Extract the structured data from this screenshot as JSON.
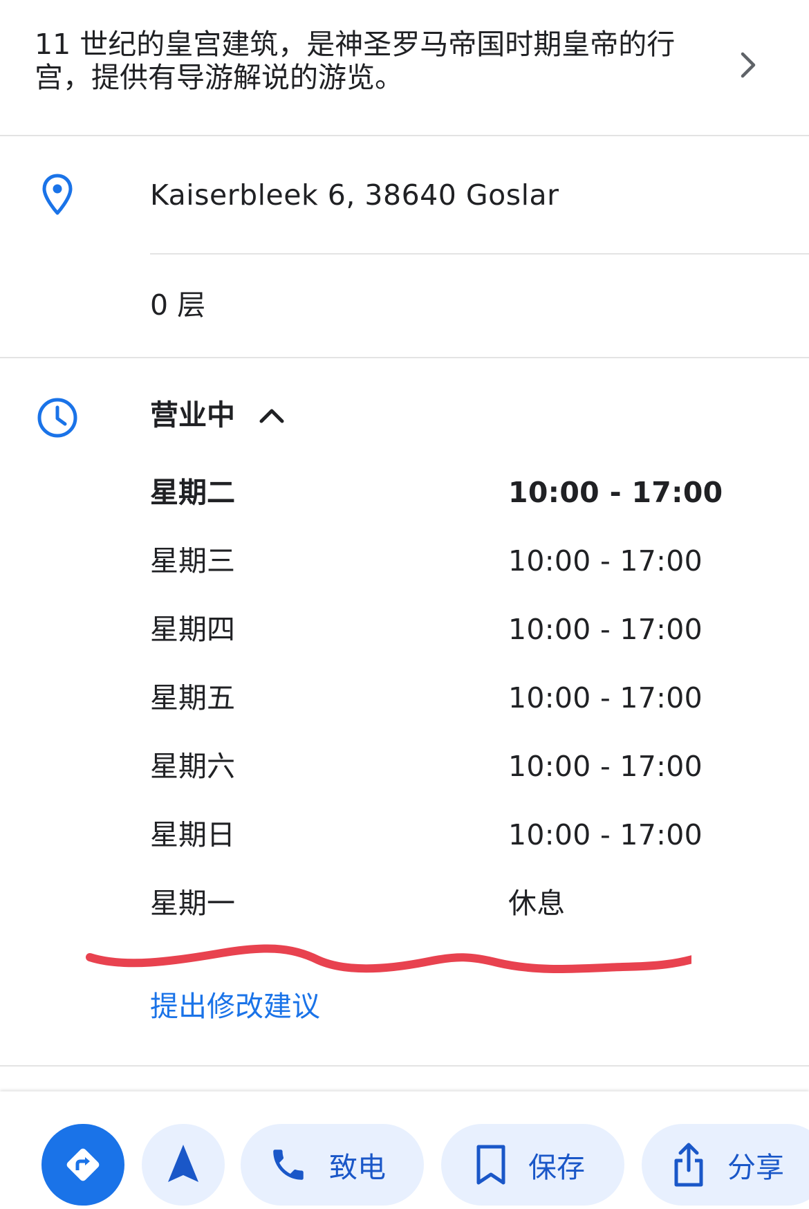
{
  "description": "11 世纪的皇宫建筑，是神圣罗马帝国时期皇帝的行宫，提供有导游解说的游览。",
  "address": "Kaiserbleek 6, 38640 Goslar",
  "floor": "0 层",
  "hours": {
    "status": "营业中",
    "days": [
      {
        "day": "星期二",
        "time": "10:00 - 17:00"
      },
      {
        "day": "星期三",
        "time": "10:00 - 17:00"
      },
      {
        "day": "星期四",
        "time": "10:00 - 17:00"
      },
      {
        "day": "星期五",
        "time": "10:00 - 17:00"
      },
      {
        "day": "星期六",
        "time": "10:00 - 17:00"
      },
      {
        "day": "星期日",
        "time": "10:00 - 17:00"
      },
      {
        "day": "星期一",
        "time": "休息"
      }
    ],
    "current_day": "星期二"
  },
  "suggest_edit": "提出修改建议",
  "actions": {
    "call": "致电",
    "save": "保存",
    "share": "分享"
  },
  "icons": {
    "description": "chevron-right-icon",
    "address": "location-pin-icon",
    "hours": "clock-icon",
    "hours_toggle": "chevron-up-icon",
    "directions": "directions-icon",
    "start": "navigation-arrow-icon",
    "call": "phone-icon",
    "save": "bookmark-icon",
    "share": "share-icon"
  },
  "colors": {
    "accent": "#1a73e8",
    "pill_bg": "#e8f0fe",
    "annotation_stroke": "#e8424f"
  }
}
